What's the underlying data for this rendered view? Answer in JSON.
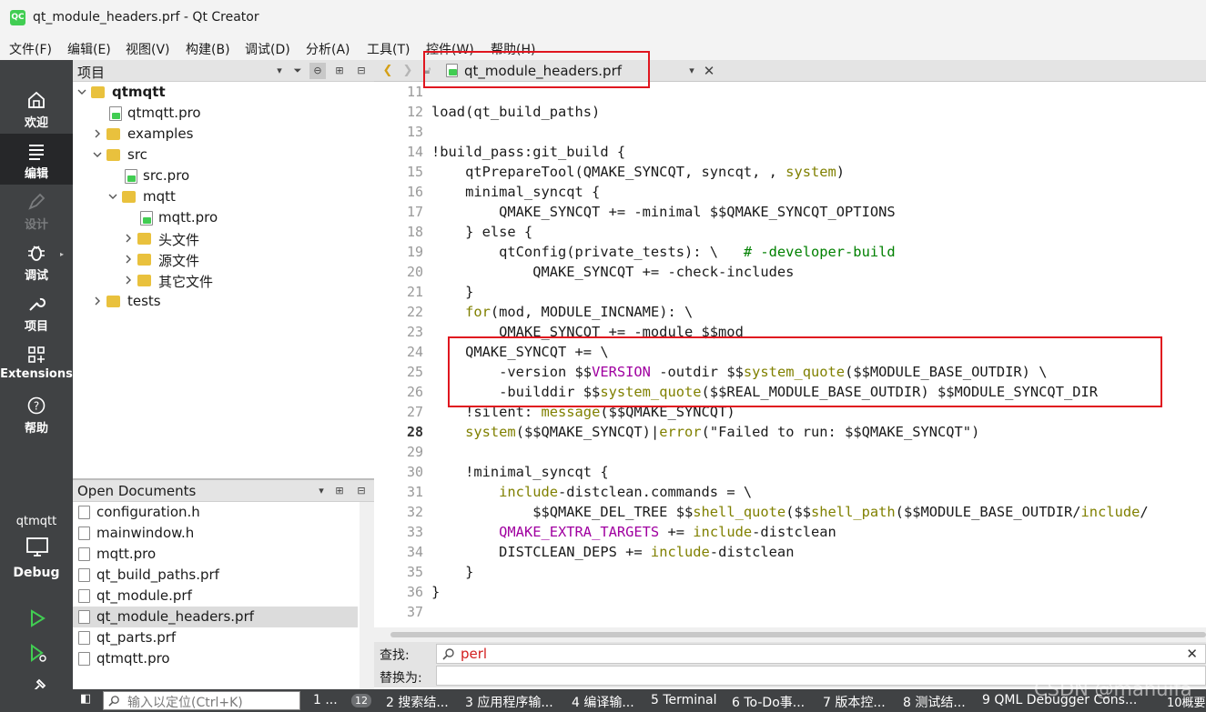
{
  "window": {
    "app_icon_text": "QC",
    "title": "qt_module_headers.prf - Qt Creator"
  },
  "menubar": [
    "文件(F)",
    "编辑(E)",
    "视图(V)",
    "构建(B)",
    "调试(D)",
    "分析(A)",
    "工具(T)",
    "控件(W)",
    "帮助(H)"
  ],
  "modes": [
    {
      "label": "欢迎",
      "icon": "home-icon"
    },
    {
      "label": "编辑",
      "icon": "edit-icon",
      "active": true
    },
    {
      "label": "设计",
      "icon": "design-icon",
      "disabled": true
    },
    {
      "label": "调试",
      "icon": "bug-icon"
    },
    {
      "label": "项目",
      "icon": "wrench-icon"
    },
    {
      "label": "Extensions",
      "icon": "extensions-icon"
    },
    {
      "label": "帮助",
      "icon": "help-icon"
    }
  ],
  "kit": {
    "project": "qtmqtt",
    "config": "Debug",
    "icon": "monitor-icon"
  },
  "project_pane": {
    "title": "项目",
    "tree": [
      {
        "label": "qtmqtt",
        "bold": true
      },
      {
        "label": "qtmqtt.pro"
      },
      {
        "label": "examples"
      },
      {
        "label": "src"
      },
      {
        "label": "src.pro"
      },
      {
        "label": "mqtt"
      },
      {
        "label": "mqtt.pro"
      },
      {
        "label": "头文件"
      },
      {
        "label": "源文件"
      },
      {
        "label": "其它文件"
      },
      {
        "label": "tests"
      }
    ]
  },
  "open_documents": {
    "title": "Open Documents",
    "items": [
      "configuration.h",
      "mainwindow.h",
      "mqtt.pro",
      "qt_build_paths.prf",
      "qt_module.prf",
      "qt_module_headers.prf",
      "qt_parts.prf",
      "qtmqtt.pro"
    ],
    "selected_index": 5
  },
  "editor": {
    "tab_title": "qt_module_headers.prf",
    "line_numbers": [
      "11",
      "12",
      "13",
      "14",
      "15",
      "16",
      "17",
      "18",
      "19",
      "20",
      "21",
      "22",
      "23",
      "24",
      "25",
      "26",
      "27",
      "28",
      "29",
      "30",
      "31",
      "32",
      "33",
      "34",
      "35",
      "36",
      "37"
    ],
    "current_line": "28",
    "lines": [
      "",
      "load(qt_build_paths)",
      "",
      "!build_pass:git_build {",
      "    qtPrepareTool(QMAKE_SYNCQT, syncqt, , system)",
      "    minimal_syncqt {",
      "        QMAKE_SYNCQT += -minimal $$QMAKE_SYNCQT_OPTIONS",
      "    } else {",
      "        qtConfig(private_tests): \\   # -developer-build",
      "            QMAKE_SYNCQT += -check-includes",
      "    }",
      "    for(mod, MODULE_INCNAME): \\",
      "        QMAKE_SYNCQT += -module $$mod",
      "    QMAKE_SYNCQT += \\",
      "        -version $$VERSION -outdir $$system_quote($$MODULE_BASE_OUTDIR) \\",
      "        -builddir $$system_quote($$REAL_MODULE_BASE_OUTDIR) $$MODULE_SYNCQT_DIR",
      "    !silent: message($$QMAKE_SYNCQT)",
      "    system($$QMAKE_SYNCQT)|error(\"Failed to run: $$QMAKE_SYNCQT\")",
      "",
      "    !minimal_syncqt {",
      "        include-distclean.commands = \\",
      "            $$QMAKE_DEL_TREE $$shell_quote($$shell_path($$MODULE_BASE_OUTDIR/include/",
      "        QMAKE_EXTRA_TARGETS += include-distclean",
      "        DISTCLEAN_DEPS += include-distclean",
      "    }",
      "}",
      ""
    ]
  },
  "find": {
    "find_label": "查找:",
    "replace_label": "替换为:",
    "find_value": "perl",
    "replace_value": ""
  },
  "statusbar": {
    "locator_placeholder": "输入以定位(Ctrl+K)",
    "items": [
      "1 ...",
      "12",
      "2 搜索结...",
      "3 应用程序输...",
      "4 编译输...",
      "5 Terminal",
      "6 To-Do事...",
      "7 版本控...",
      "8 测试结...",
      "9 QML Debugger Cons...",
      "10概要"
    ]
  },
  "watermark": "CSDN @mahuifa",
  "colors": {
    "highlight": "#e0161f",
    "modebar": "#404244",
    "keyword": "#808000",
    "function": "#00677c",
    "variable": "#a000a0",
    "comment": "#008000"
  }
}
